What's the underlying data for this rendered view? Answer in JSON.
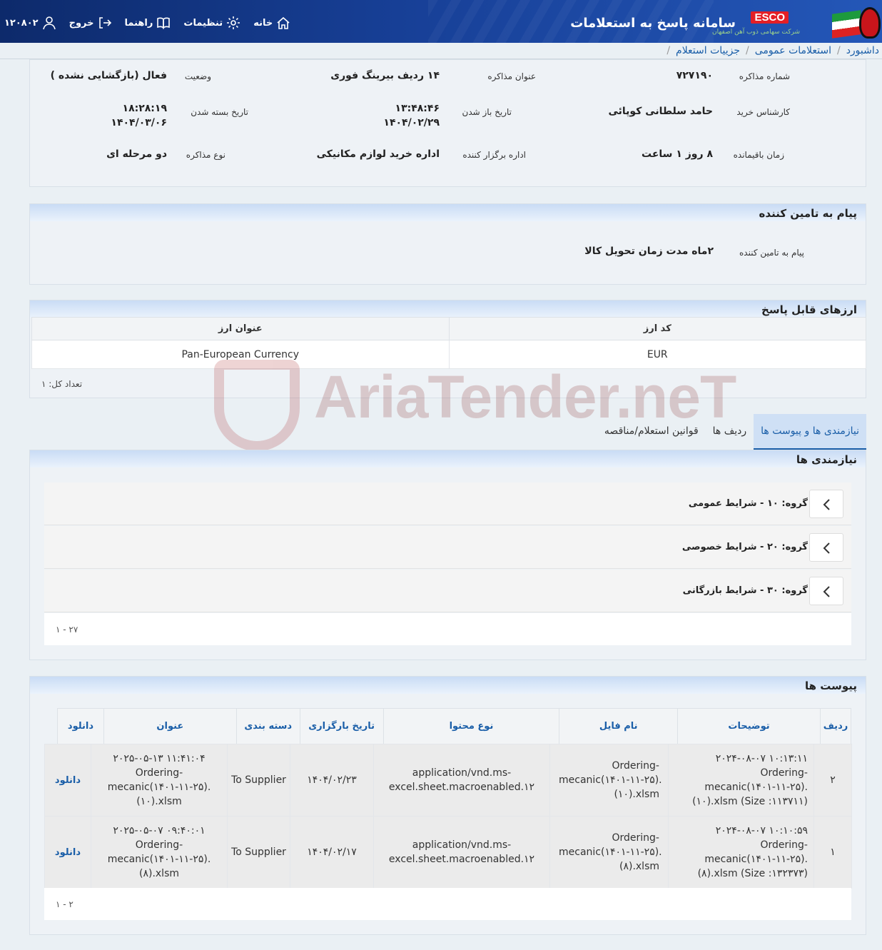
{
  "header": {
    "app_title": "سامانه پاسخ به استعلامات",
    "logo_text": "ESCO",
    "logo_subtitle": "شرکت سهامی ذوب آهن اصفهان",
    "nav": {
      "home": "خانه",
      "settings": "تنظیمات",
      "guide": "راهنما",
      "logout": "خروج",
      "user_id": "۱۲۰۸۰۲"
    }
  },
  "breadcrumb": {
    "items": [
      "داشبورد",
      "استعلامات عمومی",
      "جزییات استعلام"
    ]
  },
  "summary": {
    "tender_number_label": "شماره مذاکره",
    "tender_number": "۷۲۷۱۹۰",
    "title_label": "عنوان مذاکره",
    "title": "۱۴ ردیف بیرینگ فوری",
    "status_label": "وضعیت",
    "status": "فعال (بازگشایی نشده )",
    "buyer_label": "کارشناس خرید",
    "buyer": "حامد سلطانی کوپائی",
    "open_date_label": "تاریخ باز شدن",
    "open_time": "۱۳:۴۸:۴۶",
    "open_date": "۱۴۰۴/۰۲/۲۹",
    "close_date_label": "تاریخ بسته شدن",
    "close_time": "۱۸:۲۸:۱۹",
    "close_date": "۱۴۰۴/۰۳/۰۶",
    "remaining_label": "زمان باقیمانده",
    "remaining": "۸ روز ۱ ساعت",
    "organizer_label": "اداره برگزار کننده",
    "organizer": "اداره خرید لوازم مکانیکی",
    "type_label": "نوع مذاکره",
    "type": "دو مرحله ای"
  },
  "supplier_message": {
    "heading": "پیام به تامین کننده",
    "label": "پیام به تامین کننده",
    "text": "۲ماه مدت زمان تحویل کالا"
  },
  "currencies": {
    "heading": "ارزهای قابل پاسخ",
    "columns": {
      "code": "کد ارز",
      "title": "عنوان ارز"
    },
    "rows": [
      {
        "code": "EUR",
        "title": "Pan-European Currency"
      }
    ],
    "total": "تعداد کل: ۱"
  },
  "tabs": [
    "نیازمندی ها و پیوست ها",
    "ردیف ها",
    "قوانین استعلام/مناقصه"
  ],
  "requirements": {
    "heading": "نیازمندی ها",
    "groups": [
      "گروه: ۱۰ - شرایط عمومی",
      "گروه: ۲۰ - شرایط خصوصی",
      "گروه: ۳۰ - شرایط بازرگانی"
    ],
    "pager": "۱ - ۲۷"
  },
  "attachments": {
    "heading": "پیوست ها",
    "columns": {
      "row": "ردیف",
      "desc": "توضیحات",
      "file": "نام فایل",
      "ctype": "نوع محتوا",
      "date": "تاریخ بارگزاری",
      "cat": "دسته بندی",
      "title": "عنوان",
      "download": "دانلود"
    },
    "rows": [
      {
        "row": "۲",
        "desc": "۲۰۲۴-۰۸-۰۷ ۱۰:۱۳:۱۱ Ordering-mecanic(۱۴۰۱-۱۱-۲۵). (۱۰).xlsm (Size :۱۱۳۷۱۱)",
        "file": "Ordering-mecanic(۱۴۰۱-۱۱-۲۵). (۱۰).xlsm",
        "ctype": "application/vnd.ms-excel.sheet.macroenabled.۱۲",
        "date": "۱۴۰۴/۰۲/۲۳",
        "cat": "To Supplier",
        "title": "۲۰۲۵-۰۵-۱۳ ۱۱:۴۱:۰۴ Ordering-mecanic(۱۴۰۱-۱۱-۲۵). (۱۰).xlsm",
        "download": "دانلود"
      },
      {
        "row": "۱",
        "desc": "۲۰۲۴-۰۸-۰۷ ۱۰:۱۰:۵۹ Ordering-mecanic(۱۴۰۱-۱۱-۲۵). (۸).xlsm (Size :۱۳۲۳۷۳)",
        "file": "Ordering-mecanic(۱۴۰۱-۱۱-۲۵). (۸).xlsm",
        "ctype": "application/vnd.ms-excel.sheet.macroenabled.۱۲",
        "date": "۱۴۰۴/۰۲/۱۷",
        "cat": "To Supplier",
        "title": "۲۰۲۵-۰۵-۰۷ ۰۹:۴۰:۰۱ Ordering-mecanic(۱۴۰۱-۱۱-۲۵). (۸).xlsm",
        "download": "دانلود"
      }
    ],
    "pager": "۱ - ۲"
  },
  "watermark": {
    "text": "AriaTender.neT"
  }
}
